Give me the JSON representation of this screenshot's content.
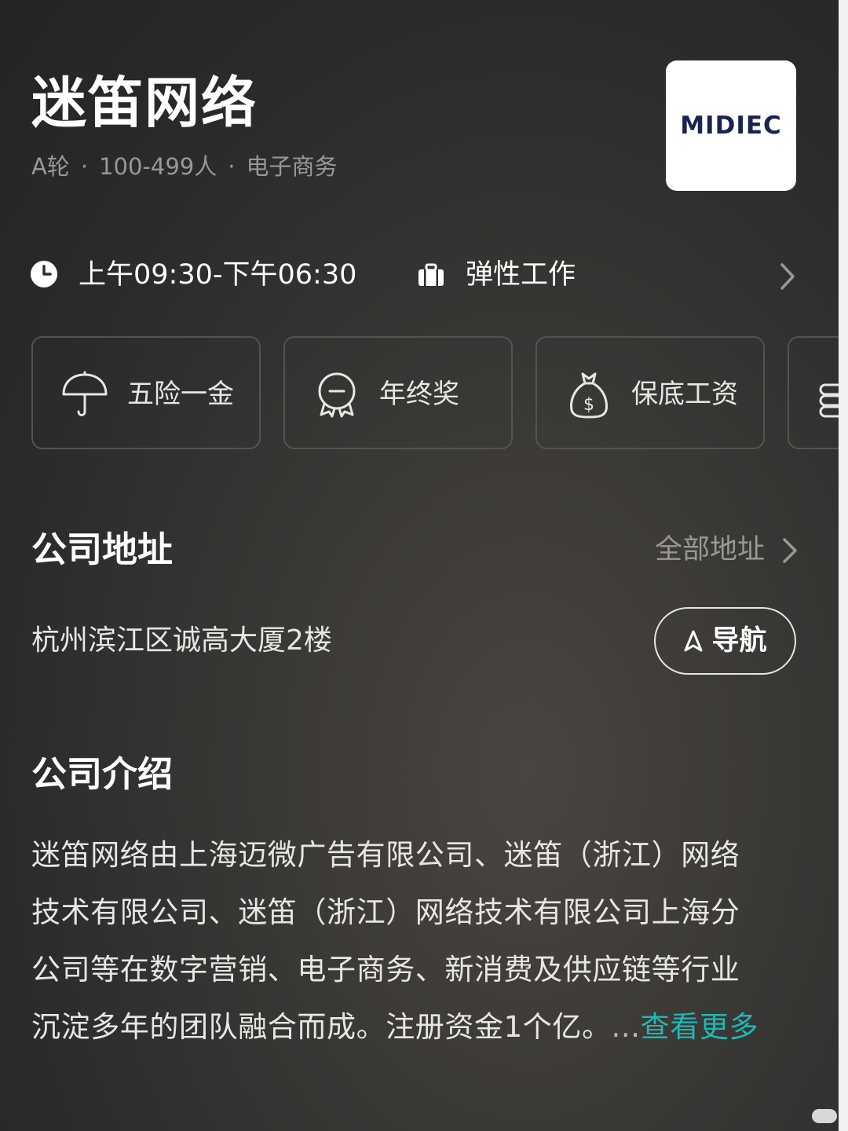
{
  "company": {
    "name": "迷笛网络",
    "funding": "A轮",
    "size": "100-499人",
    "industry": "电子商务",
    "separator": "·",
    "logo_text": "MIDIEC"
  },
  "work": {
    "hours": "上午09:30-下午06:30",
    "type": "弹性工作"
  },
  "benefits": [
    {
      "label": "五险一金",
      "icon": "umbrella-icon"
    },
    {
      "label": "年终奖",
      "icon": "medal-icon"
    },
    {
      "label": "保底工资",
      "icon": "money-bag-icon"
    },
    {
      "label": "",
      "icon": "coins-icon"
    }
  ],
  "address": {
    "title": "公司地址",
    "all_link": "全部地址",
    "text": "杭州滨江区诚高大厦2楼",
    "nav_label": "导航"
  },
  "intro": {
    "title": "公司介绍",
    "lines": [
      "迷笛网络由上海迈微广告有限公司、迷笛（浙江）网络",
      "技术有限公司、迷笛（浙江）网络技术有限公司上海分",
      "公司等在数字营销、电子商务、新消费及供应链等行业",
      "沉淀多年的团队融合而成。注册资金1个亿。"
    ],
    "ellipsis": "...",
    "more_label": "查看更多"
  },
  "colors": {
    "accent": "#1fb8b5",
    "muted": "#9a9895",
    "logo_text": "#1a2450"
  }
}
